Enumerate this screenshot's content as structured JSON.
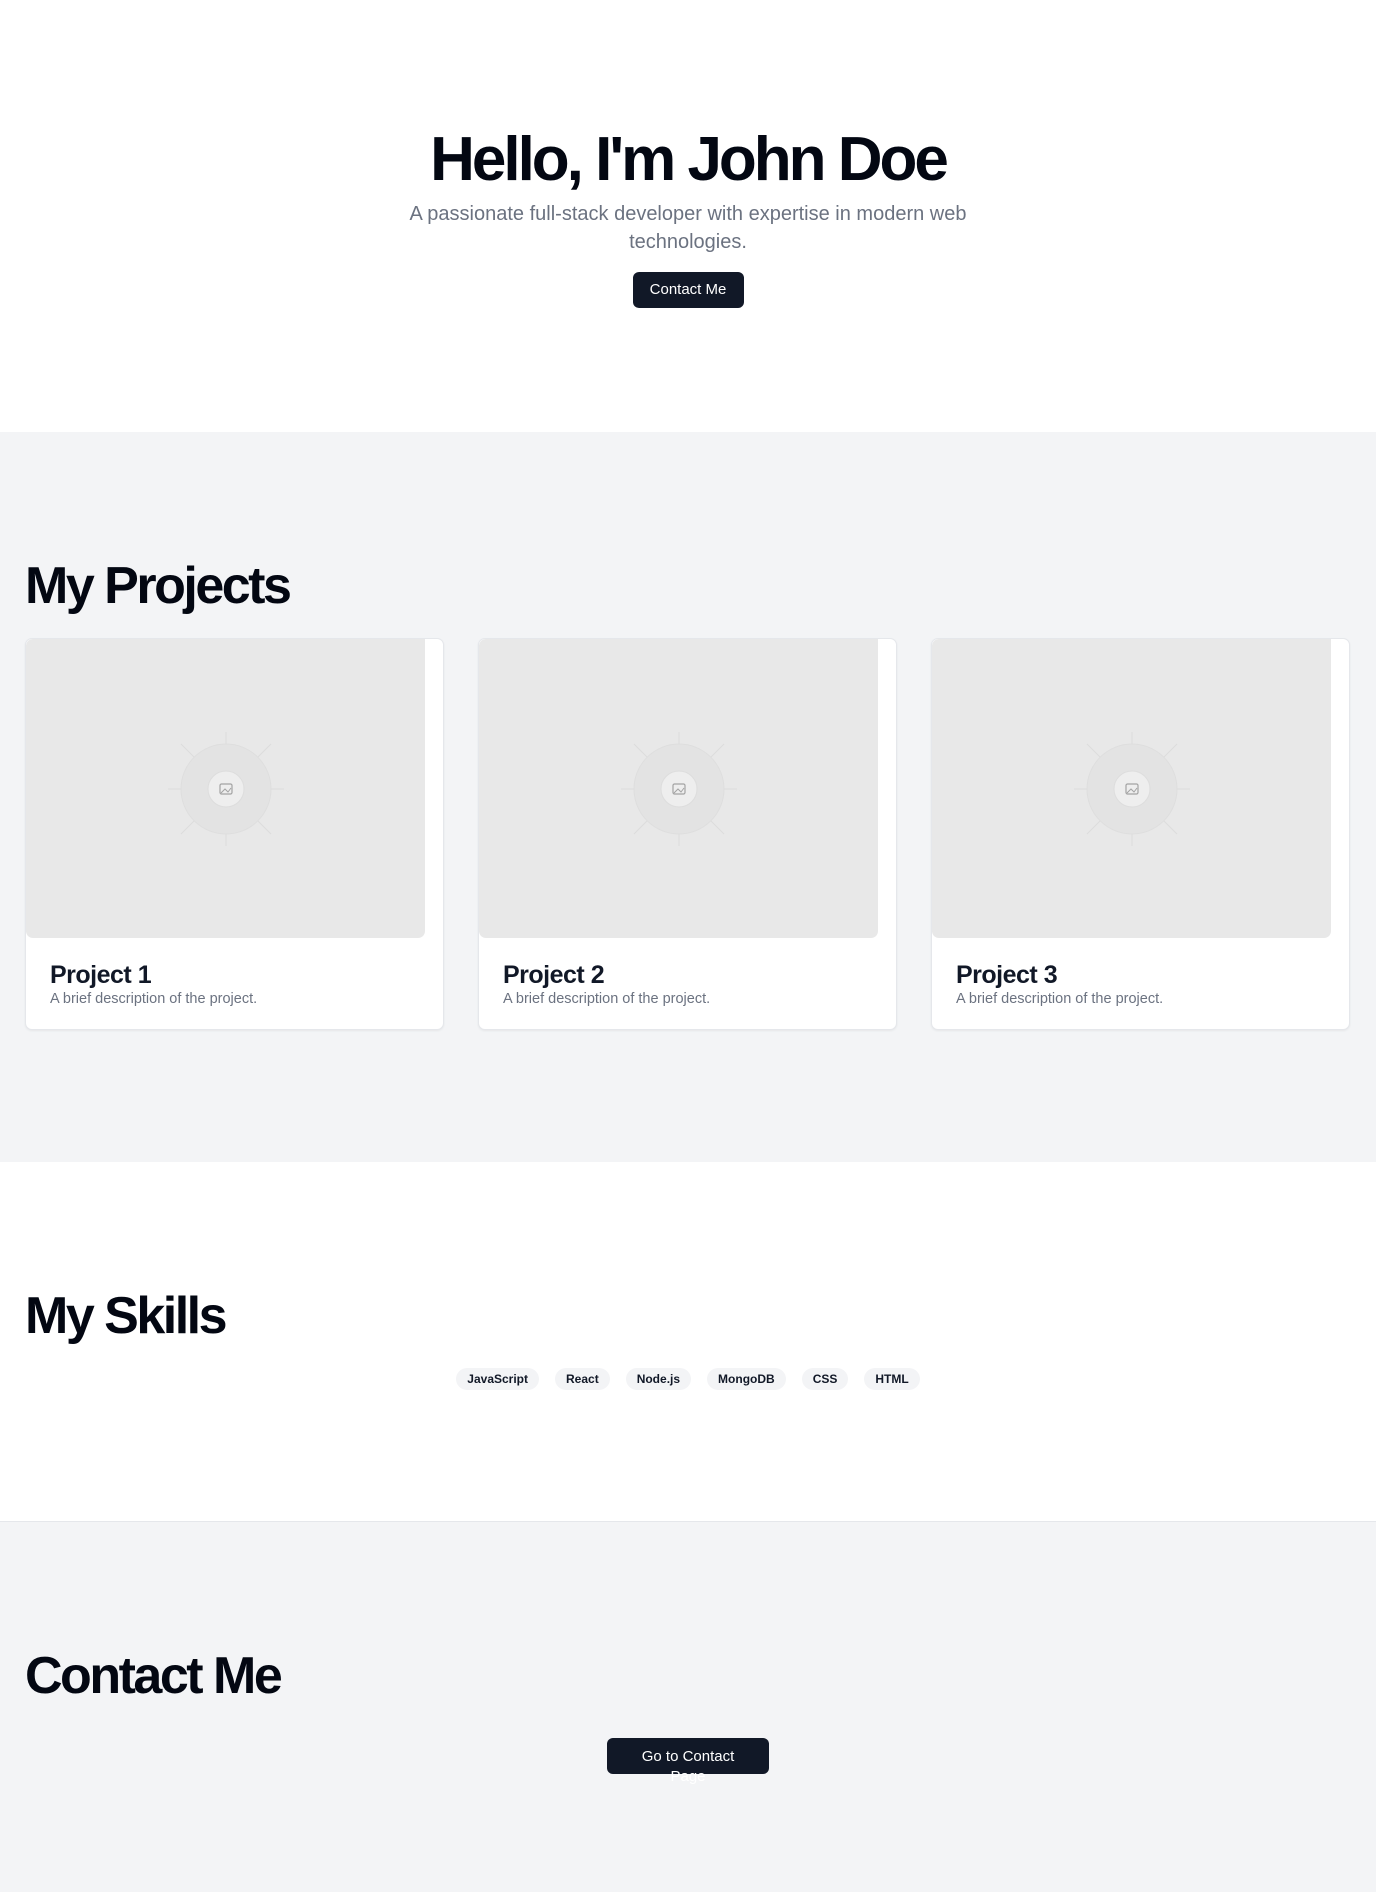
{
  "hero": {
    "title": "Hello, I'm John Doe",
    "subtitle": "A passionate full-stack developer with expertise in modern web technologies.",
    "cta_label": "Contact Me"
  },
  "projects": {
    "title": "My Projects",
    "items": [
      {
        "title": "Project 1",
        "description": "A brief description of the project.",
        "image_icon": "image-placeholder-icon"
      },
      {
        "title": "Project 2",
        "description": "A brief description of the project.",
        "image_icon": "image-placeholder-icon"
      },
      {
        "title": "Project 3",
        "description": "A brief description of the project.",
        "image_icon": "image-placeholder-icon"
      }
    ]
  },
  "skills": {
    "title": "My Skills",
    "items": [
      "JavaScript",
      "React",
      "Node.js",
      "MongoDB",
      "CSS",
      "HTML"
    ]
  },
  "contact": {
    "title": "Contact Me",
    "cta_label": "Go to Contact Page"
  },
  "colors": {
    "primary_button": "#111827",
    "section_alt_bg": "#f3f4f6",
    "muted_text": "#6b7280",
    "placeholder_bg": "#e8e8e8"
  }
}
